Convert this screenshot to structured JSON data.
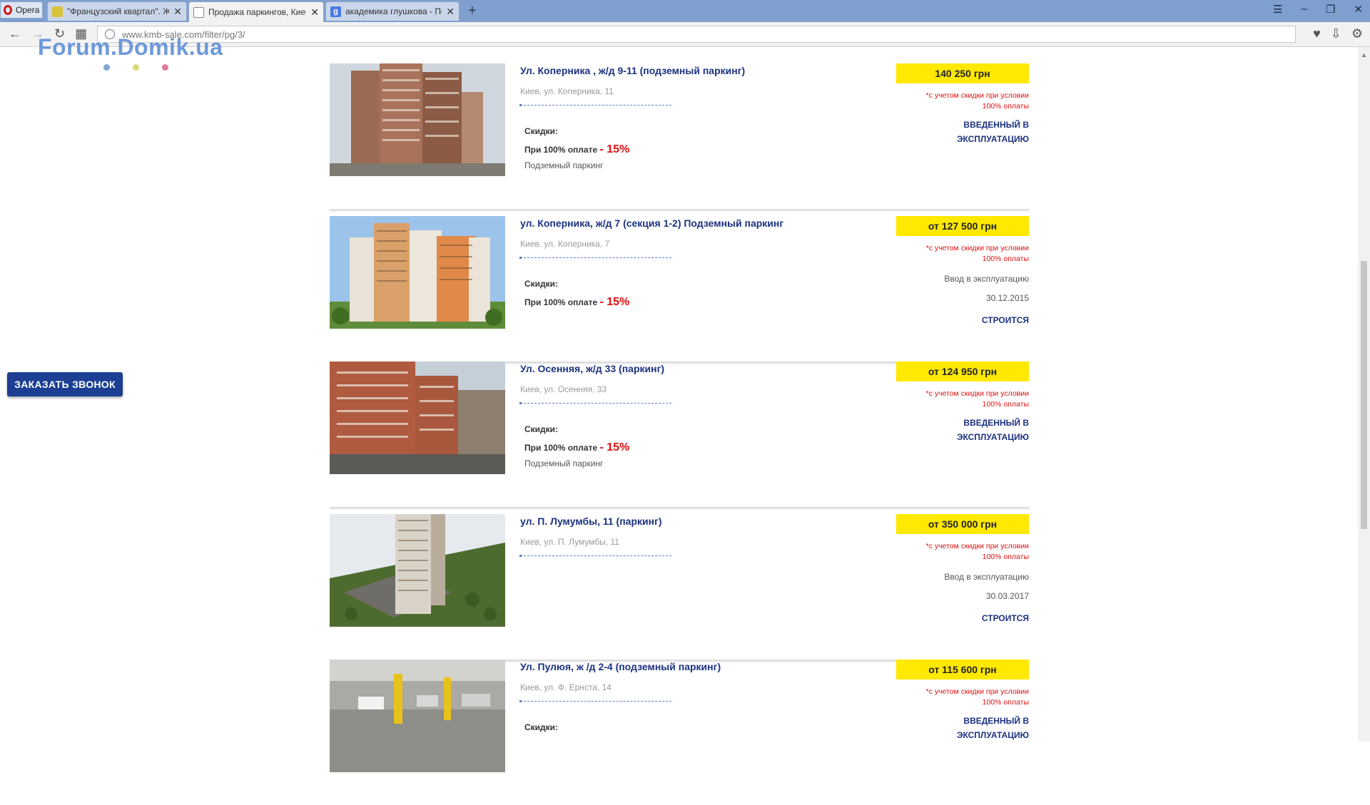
{
  "browser": {
    "menu_label": "Opera",
    "tabs": [
      {
        "title": "\"Французский квартал\". Ж"
      },
      {
        "title": "Продажа паркингов, Киев"
      },
      {
        "title": "академика глушкова - По"
      }
    ],
    "new_tab": "+",
    "url": "www.kmb-sale.com/filter/pg/3/"
  },
  "watermark": {
    "text": "Forum.Domik.ua",
    "dot_colors": [
      "#7fa9d9",
      "#d9d97a",
      "#e07a9c"
    ]
  },
  "callback": {
    "label": "ЗАКАЗАТЬ ЗВОНОК"
  },
  "accent": {
    "brand_blue": "#1c3280",
    "price_yellow": "#ffe900",
    "discount_red": "#e01010"
  },
  "listings": [
    {
      "title": "Ул. Коперника , ж/д 9-11 (подземный паркинг)",
      "address": "Киев, ул. Коперника, 11",
      "discount_header": "Скидки:",
      "discount_text": "При 100% оплате",
      "discount_value": "- 15%",
      "type": "Подземный паркинг",
      "price": "140 250 грн",
      "note_line1": "*с учетом скидки при условии",
      "note_line2": "100% оплаты",
      "status_line1": "ВВЕДЕННЫЙ В",
      "status_line2": "ЭКСПЛУАТАЦИЮ"
    },
    {
      "title": "ул. Коперника, ж/д 7 (секция 1-2) Подземный паркинг",
      "address": "Киев. ул. Коперника, 7",
      "discount_header": "Скидки:",
      "discount_text": "При 100% оплате",
      "discount_value": "- 15%",
      "price": "от 127 500 грн",
      "note_line1": "*с учетом скидки при условии",
      "note_line2": "100% оплаты",
      "move_in_label": "Ввод в эксплуатацию",
      "move_in_date": "30.12.2015",
      "status": "СТРОИТСЯ"
    },
    {
      "title": "Ул. Осенняя, ж/д 33 (паркинг)",
      "address": "Киев, ул. Осенняя, 33",
      "discount_header": "Скидки:",
      "discount_text": "При 100% оплате",
      "discount_value": "- 15%",
      "type": "Подземный паркинг",
      "price": "от 124 950 грн",
      "note_line1": "*с учетом скидки при условии",
      "note_line2": "100% оплаты",
      "status_line1": "ВВЕДЕННЫЙ В",
      "status_line2": "ЭКСПЛУАТАЦИЮ"
    },
    {
      "title": "ул. П. Лумумбы, 11 (паркинг)",
      "address": "Киев, ул. П. Лумумбы, 11",
      "price": "от 350 000 грн",
      "note_line1": "*с учетом скидки при условии",
      "note_line2": "100% оплаты",
      "move_in_label": "Ввод в эксплуатацию",
      "move_in_date": "30.03.2017",
      "status": "СТРОИТСЯ"
    },
    {
      "title": "Ул. Пулюя, ж /д 2-4 (подземный паркинг)",
      "address": "Киев, ул. Ф. Ернста, 14",
      "discount_header": "Скидки:",
      "price": "от 115 600 грн",
      "note_line1": "*с учетом скидки при условии",
      "note_line2": "100% оплаты",
      "status_line1": "ВВЕДЕННЫЙ В",
      "status_line2": "ЭКСПЛУАТАЦИЮ"
    }
  ]
}
